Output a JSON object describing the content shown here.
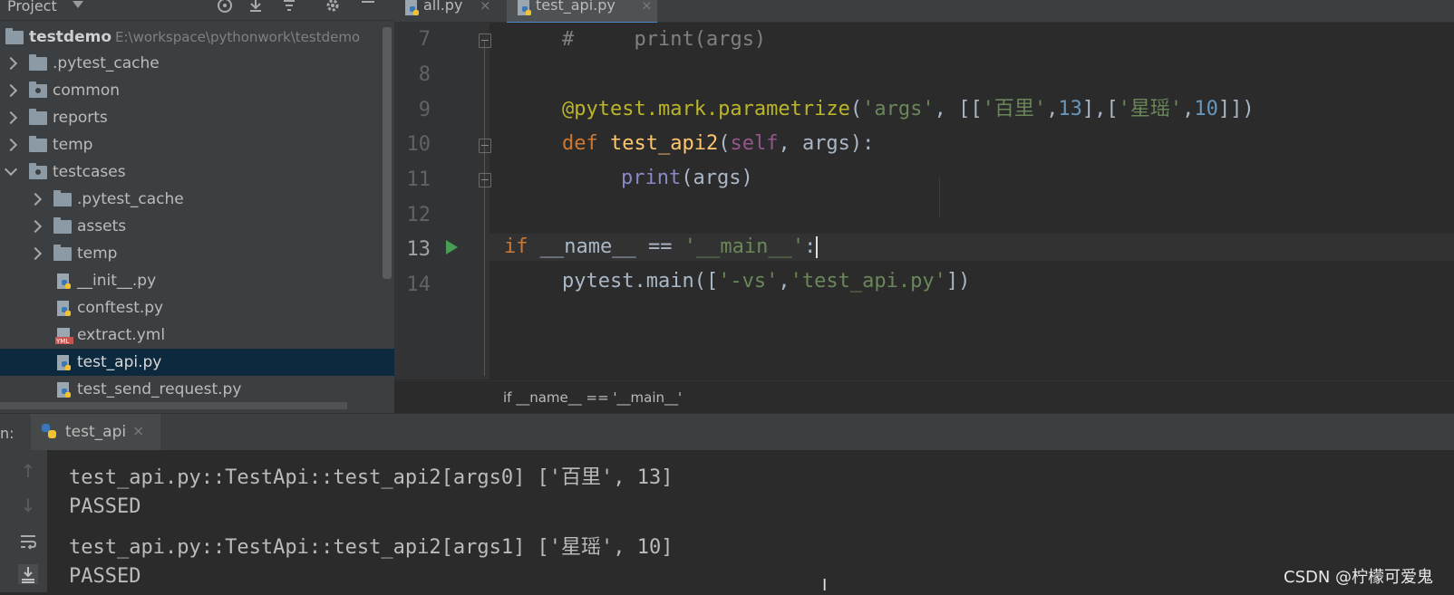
{
  "project_panel": {
    "title": "Project",
    "root": {
      "name": "testdemo",
      "path": "E:\\workspace\\pythonwork\\testdemo"
    },
    "items": [
      {
        "label": ".pytest_cache",
        "type": "folder"
      },
      {
        "label": "common",
        "type": "package"
      },
      {
        "label": "reports",
        "type": "folder"
      },
      {
        "label": "temp",
        "type": "folder"
      },
      {
        "label": "testcases",
        "type": "package"
      },
      {
        "label": ".pytest_cache",
        "type": "folder"
      },
      {
        "label": "assets",
        "type": "folder"
      },
      {
        "label": "temp",
        "type": "folder"
      },
      {
        "label": "__init__.py",
        "type": "python"
      },
      {
        "label": "conftest.py",
        "type": "python"
      },
      {
        "label": "extract.yml",
        "type": "yml"
      },
      {
        "label": "test_api.py",
        "type": "python",
        "selected": true
      },
      {
        "label": "test_send_request.py",
        "type": "python"
      }
    ]
  },
  "editor_tabs": [
    {
      "label": "all.py",
      "active": false
    },
    {
      "label": "test_api.py",
      "active": true
    }
  ],
  "editor": {
    "line_numbers": [
      "7",
      "8",
      "9",
      "10",
      "11",
      "12",
      "13",
      "14"
    ],
    "current_line": "13",
    "code": {
      "l7_hash": "#",
      "l7_print": "print(args)",
      "l9_decorator": "@pytest.mark.parametrize",
      "l9_open": "(",
      "l9_str_args": "'args'",
      "l9_comma1": ", [[",
      "l9_str_baili": "'百里'",
      "l9_c2": ",",
      "l9_n13": "13",
      "l9_mid": "],[",
      "l9_str_xingyao": "'星瑶'",
      "l9_c3": ",",
      "l9_n10": "10",
      "l9_close": "]])",
      "l10_def": "def",
      "l10_fn": "test_api2",
      "l10_open": "(",
      "l10_self": "self",
      "l10_rest": ", args):",
      "l11_print": "print",
      "l11_rest": "(args)",
      "l13_if": "if",
      "l13_name": " __name__ == ",
      "l13_str": "'__main__'",
      "l13_colon": ":",
      "l14_call": "pytest.main([",
      "l14_str1": "'-vs'",
      "l14_comma": ",",
      "l14_str2": "'test_api.py'",
      "l14_close": "])"
    }
  },
  "breadcrumb": "if __name__ == '__main__'",
  "run_panel": {
    "prefix": "n:",
    "tab_label": "test_api",
    "output": [
      "test_api.py::TestApi::test_api2[args0] ['百里', 13]",
      "PASSED",
      "test_api.py::TestApi::test_api2[args1] ['星瑶', 10]",
      "PASSED"
    ]
  },
  "watermark": "CSDN @柠檬可爱鬼"
}
